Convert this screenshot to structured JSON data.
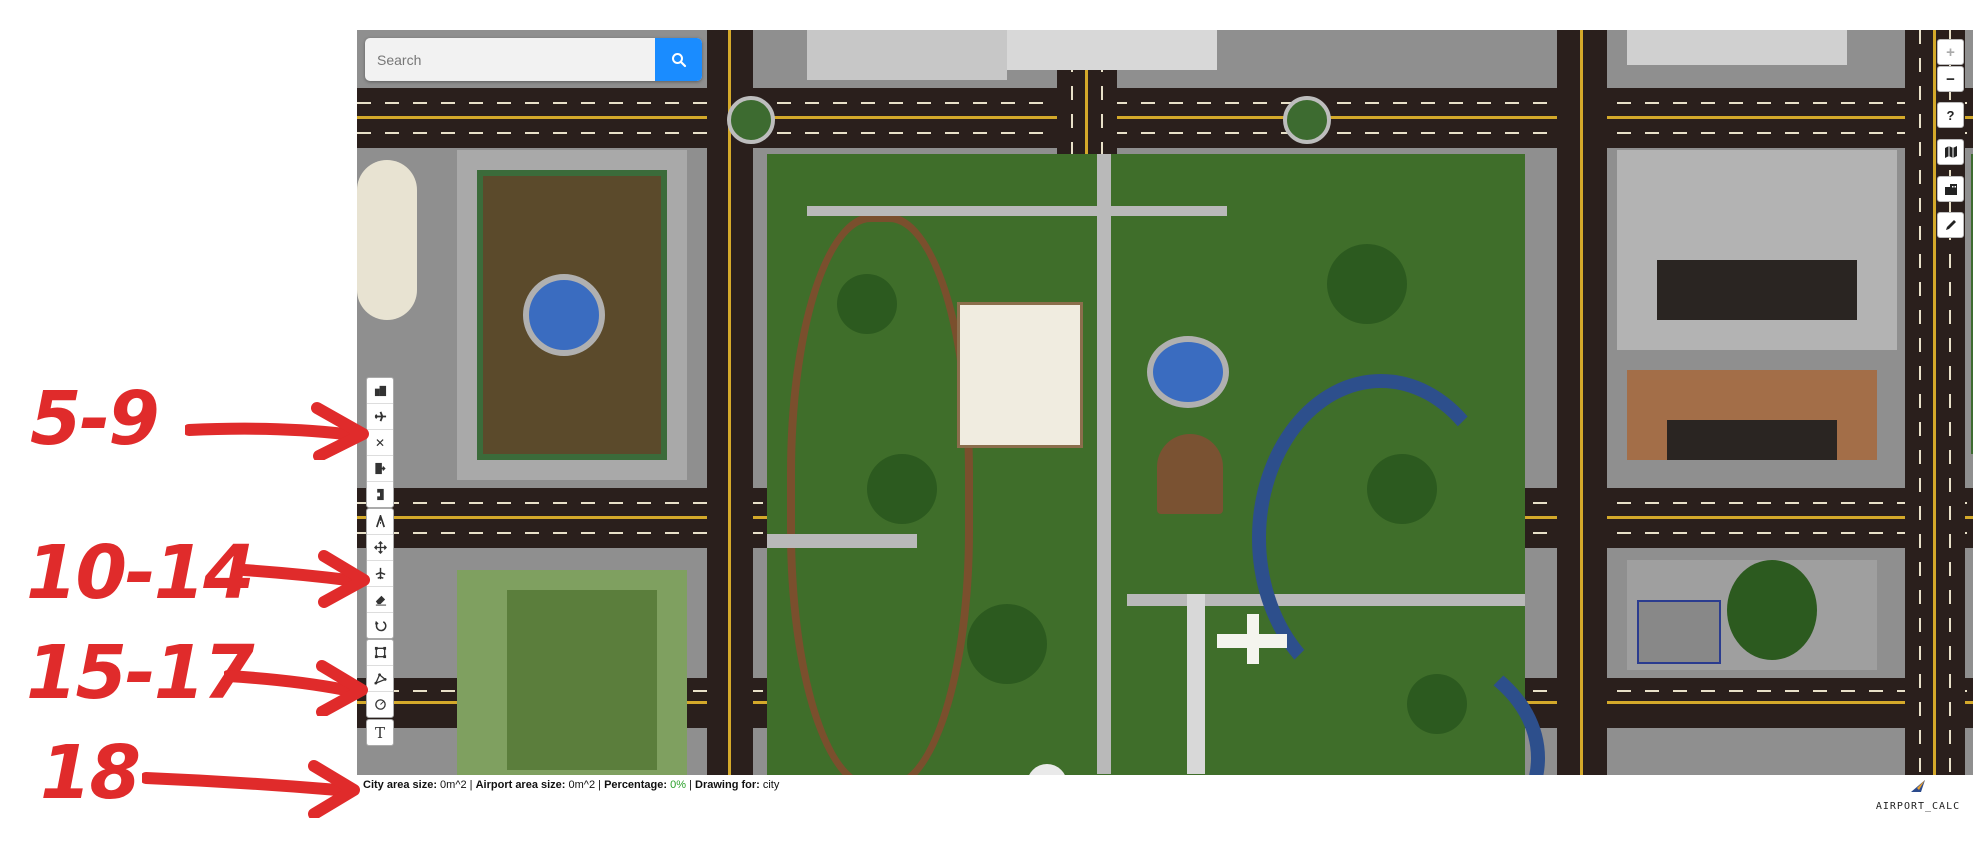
{
  "search": {
    "placeholder": "Search"
  },
  "right_controls": {
    "zoom_in": "+",
    "zoom_out": "−",
    "help": "?"
  },
  "toolbar": {
    "group1": [
      "building-icon",
      "plane-icon",
      "close-icon",
      "export-icon",
      "import-icon"
    ],
    "group2": [
      "runway-icon",
      "move-icon",
      "airplane-rotate-icon",
      "eraser-icon",
      "undo-icon"
    ],
    "group3": [
      "rectangle-icon",
      "polygon-icon",
      "circle-icon"
    ],
    "group4": [
      "text-icon"
    ],
    "text_tool_label": "T"
  },
  "status": {
    "city_label": "City area size:",
    "city_value": "0m^2",
    "airport_label": "Airport area size:",
    "airport_value": "0m^2",
    "percentage_label": "Percentage:",
    "percentage_value": "0%",
    "drawing_label": "Drawing for:",
    "drawing_value": "city",
    "separator": "|"
  },
  "logo": {
    "text": "AIRPORT_CALC"
  },
  "annotations": [
    "5-9",
    "10-14",
    "15-17",
    "18"
  ],
  "colors": {
    "accent": "#1a8cff",
    "annotation": "#e02b2b",
    "park": "#3f6e2a",
    "road": "#2a1f1c",
    "percentage": "#2aa02a"
  }
}
